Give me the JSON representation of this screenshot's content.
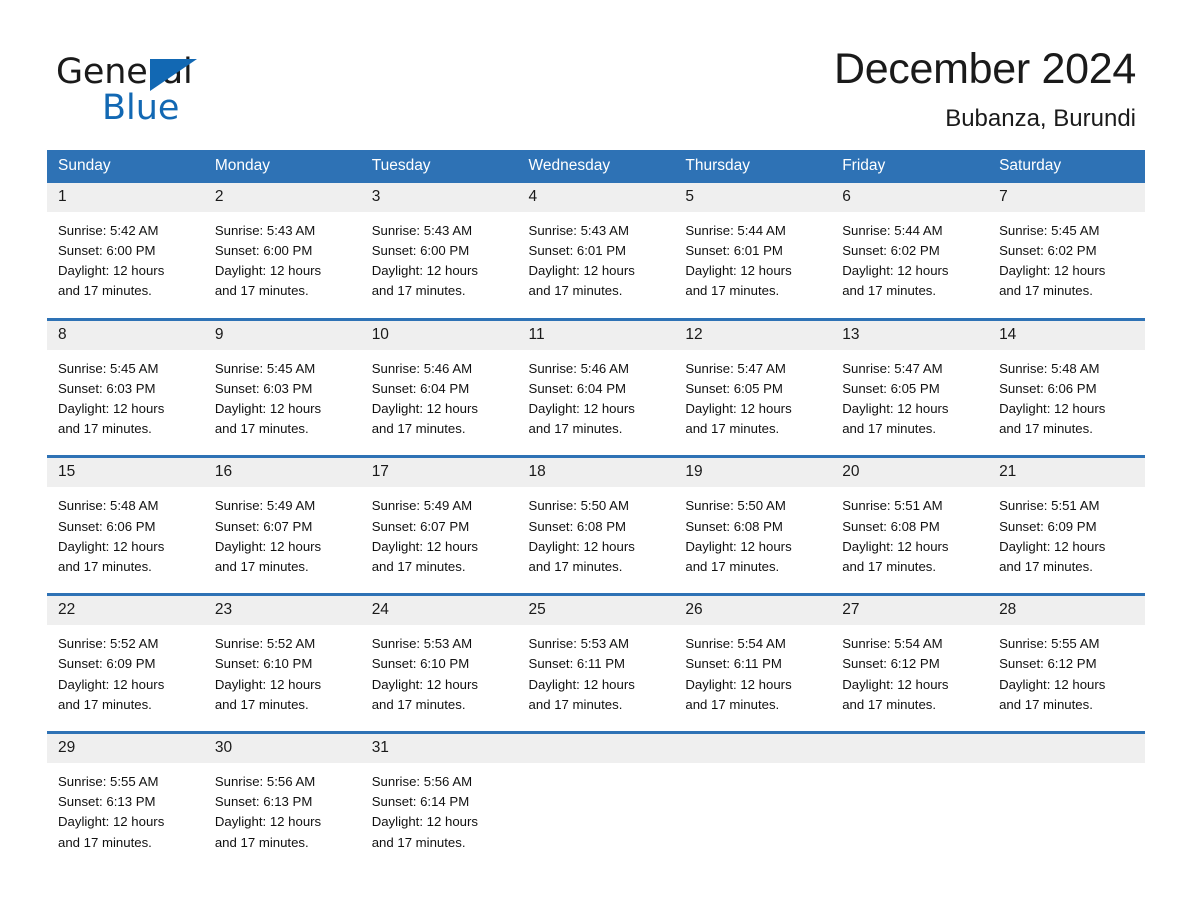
{
  "brand": {
    "word_one": "General",
    "word_two": "Blue",
    "triangle_icon": "triangle-icon"
  },
  "header": {
    "month_title": "December 2024",
    "location": "Bubanza, Burundi"
  },
  "colors": {
    "header_blue": "#2e72b5",
    "brand_blue": "#1268b3",
    "daynum_band": "#efefef",
    "text": "#1a1a1a"
  },
  "calendar": {
    "weekday_headers": [
      "Sunday",
      "Monday",
      "Tuesday",
      "Wednesday",
      "Thursday",
      "Friday",
      "Saturday"
    ],
    "weeks": [
      [
        {
          "day": "1",
          "sunrise": "Sunrise: 5:42 AM",
          "sunset": "Sunset: 6:00 PM",
          "daylight_line1": "Daylight: 12 hours",
          "daylight_line2": "and 17 minutes."
        },
        {
          "day": "2",
          "sunrise": "Sunrise: 5:43 AM",
          "sunset": "Sunset: 6:00 PM",
          "daylight_line1": "Daylight: 12 hours",
          "daylight_line2": "and 17 minutes."
        },
        {
          "day": "3",
          "sunrise": "Sunrise: 5:43 AM",
          "sunset": "Sunset: 6:00 PM",
          "daylight_line1": "Daylight: 12 hours",
          "daylight_line2": "and 17 minutes."
        },
        {
          "day": "4",
          "sunrise": "Sunrise: 5:43 AM",
          "sunset": "Sunset: 6:01 PM",
          "daylight_line1": "Daylight: 12 hours",
          "daylight_line2": "and 17 minutes."
        },
        {
          "day": "5",
          "sunrise": "Sunrise: 5:44 AM",
          "sunset": "Sunset: 6:01 PM",
          "daylight_line1": "Daylight: 12 hours",
          "daylight_line2": "and 17 minutes."
        },
        {
          "day": "6",
          "sunrise": "Sunrise: 5:44 AM",
          "sunset": "Sunset: 6:02 PM",
          "daylight_line1": "Daylight: 12 hours",
          "daylight_line2": "and 17 minutes."
        },
        {
          "day": "7",
          "sunrise": "Sunrise: 5:45 AM",
          "sunset": "Sunset: 6:02 PM",
          "daylight_line1": "Daylight: 12 hours",
          "daylight_line2": "and 17 minutes."
        }
      ],
      [
        {
          "day": "8",
          "sunrise": "Sunrise: 5:45 AM",
          "sunset": "Sunset: 6:03 PM",
          "daylight_line1": "Daylight: 12 hours",
          "daylight_line2": "and 17 minutes."
        },
        {
          "day": "9",
          "sunrise": "Sunrise: 5:45 AM",
          "sunset": "Sunset: 6:03 PM",
          "daylight_line1": "Daylight: 12 hours",
          "daylight_line2": "and 17 minutes."
        },
        {
          "day": "10",
          "sunrise": "Sunrise: 5:46 AM",
          "sunset": "Sunset: 6:04 PM",
          "daylight_line1": "Daylight: 12 hours",
          "daylight_line2": "and 17 minutes."
        },
        {
          "day": "11",
          "sunrise": "Sunrise: 5:46 AM",
          "sunset": "Sunset: 6:04 PM",
          "daylight_line1": "Daylight: 12 hours",
          "daylight_line2": "and 17 minutes."
        },
        {
          "day": "12",
          "sunrise": "Sunrise: 5:47 AM",
          "sunset": "Sunset: 6:05 PM",
          "daylight_line1": "Daylight: 12 hours",
          "daylight_line2": "and 17 minutes."
        },
        {
          "day": "13",
          "sunrise": "Sunrise: 5:47 AM",
          "sunset": "Sunset: 6:05 PM",
          "daylight_line1": "Daylight: 12 hours",
          "daylight_line2": "and 17 minutes."
        },
        {
          "day": "14",
          "sunrise": "Sunrise: 5:48 AM",
          "sunset": "Sunset: 6:06 PM",
          "daylight_line1": "Daylight: 12 hours",
          "daylight_line2": "and 17 minutes."
        }
      ],
      [
        {
          "day": "15",
          "sunrise": "Sunrise: 5:48 AM",
          "sunset": "Sunset: 6:06 PM",
          "daylight_line1": "Daylight: 12 hours",
          "daylight_line2": "and 17 minutes."
        },
        {
          "day": "16",
          "sunrise": "Sunrise: 5:49 AM",
          "sunset": "Sunset: 6:07 PM",
          "daylight_line1": "Daylight: 12 hours",
          "daylight_line2": "and 17 minutes."
        },
        {
          "day": "17",
          "sunrise": "Sunrise: 5:49 AM",
          "sunset": "Sunset: 6:07 PM",
          "daylight_line1": "Daylight: 12 hours",
          "daylight_line2": "and 17 minutes."
        },
        {
          "day": "18",
          "sunrise": "Sunrise: 5:50 AM",
          "sunset": "Sunset: 6:08 PM",
          "daylight_line1": "Daylight: 12 hours",
          "daylight_line2": "and 17 minutes."
        },
        {
          "day": "19",
          "sunrise": "Sunrise: 5:50 AM",
          "sunset": "Sunset: 6:08 PM",
          "daylight_line1": "Daylight: 12 hours",
          "daylight_line2": "and 17 minutes."
        },
        {
          "day": "20",
          "sunrise": "Sunrise: 5:51 AM",
          "sunset": "Sunset: 6:08 PM",
          "daylight_line1": "Daylight: 12 hours",
          "daylight_line2": "and 17 minutes."
        },
        {
          "day": "21",
          "sunrise": "Sunrise: 5:51 AM",
          "sunset": "Sunset: 6:09 PM",
          "daylight_line1": "Daylight: 12 hours",
          "daylight_line2": "and 17 minutes."
        }
      ],
      [
        {
          "day": "22",
          "sunrise": "Sunrise: 5:52 AM",
          "sunset": "Sunset: 6:09 PM",
          "daylight_line1": "Daylight: 12 hours",
          "daylight_line2": "and 17 minutes."
        },
        {
          "day": "23",
          "sunrise": "Sunrise: 5:52 AM",
          "sunset": "Sunset: 6:10 PM",
          "daylight_line1": "Daylight: 12 hours",
          "daylight_line2": "and 17 minutes."
        },
        {
          "day": "24",
          "sunrise": "Sunrise: 5:53 AM",
          "sunset": "Sunset: 6:10 PM",
          "daylight_line1": "Daylight: 12 hours",
          "daylight_line2": "and 17 minutes."
        },
        {
          "day": "25",
          "sunrise": "Sunrise: 5:53 AM",
          "sunset": "Sunset: 6:11 PM",
          "daylight_line1": "Daylight: 12 hours",
          "daylight_line2": "and 17 minutes."
        },
        {
          "day": "26",
          "sunrise": "Sunrise: 5:54 AM",
          "sunset": "Sunset: 6:11 PM",
          "daylight_line1": "Daylight: 12 hours",
          "daylight_line2": "and 17 minutes."
        },
        {
          "day": "27",
          "sunrise": "Sunrise: 5:54 AM",
          "sunset": "Sunset: 6:12 PM",
          "daylight_line1": "Daylight: 12 hours",
          "daylight_line2": "and 17 minutes."
        },
        {
          "day": "28",
          "sunrise": "Sunrise: 5:55 AM",
          "sunset": "Sunset: 6:12 PM",
          "daylight_line1": "Daylight: 12 hours",
          "daylight_line2": "and 17 minutes."
        }
      ],
      [
        {
          "day": "29",
          "sunrise": "Sunrise: 5:55 AM",
          "sunset": "Sunset: 6:13 PM",
          "daylight_line1": "Daylight: 12 hours",
          "daylight_line2": "and 17 minutes."
        },
        {
          "day": "30",
          "sunrise": "Sunrise: 5:56 AM",
          "sunset": "Sunset: 6:13 PM",
          "daylight_line1": "Daylight: 12 hours",
          "daylight_line2": "and 17 minutes."
        },
        {
          "day": "31",
          "sunrise": "Sunrise: 5:56 AM",
          "sunset": "Sunset: 6:14 PM",
          "daylight_line1": "Daylight: 12 hours",
          "daylight_line2": "and 17 minutes."
        },
        {
          "day": "",
          "sunrise": "",
          "sunset": "",
          "daylight_line1": "",
          "daylight_line2": ""
        },
        {
          "day": "",
          "sunrise": "",
          "sunset": "",
          "daylight_line1": "",
          "daylight_line2": ""
        },
        {
          "day": "",
          "sunrise": "",
          "sunset": "",
          "daylight_line1": "",
          "daylight_line2": ""
        },
        {
          "day": "",
          "sunrise": "",
          "sunset": "",
          "daylight_line1": "",
          "daylight_line2": ""
        }
      ]
    ]
  }
}
